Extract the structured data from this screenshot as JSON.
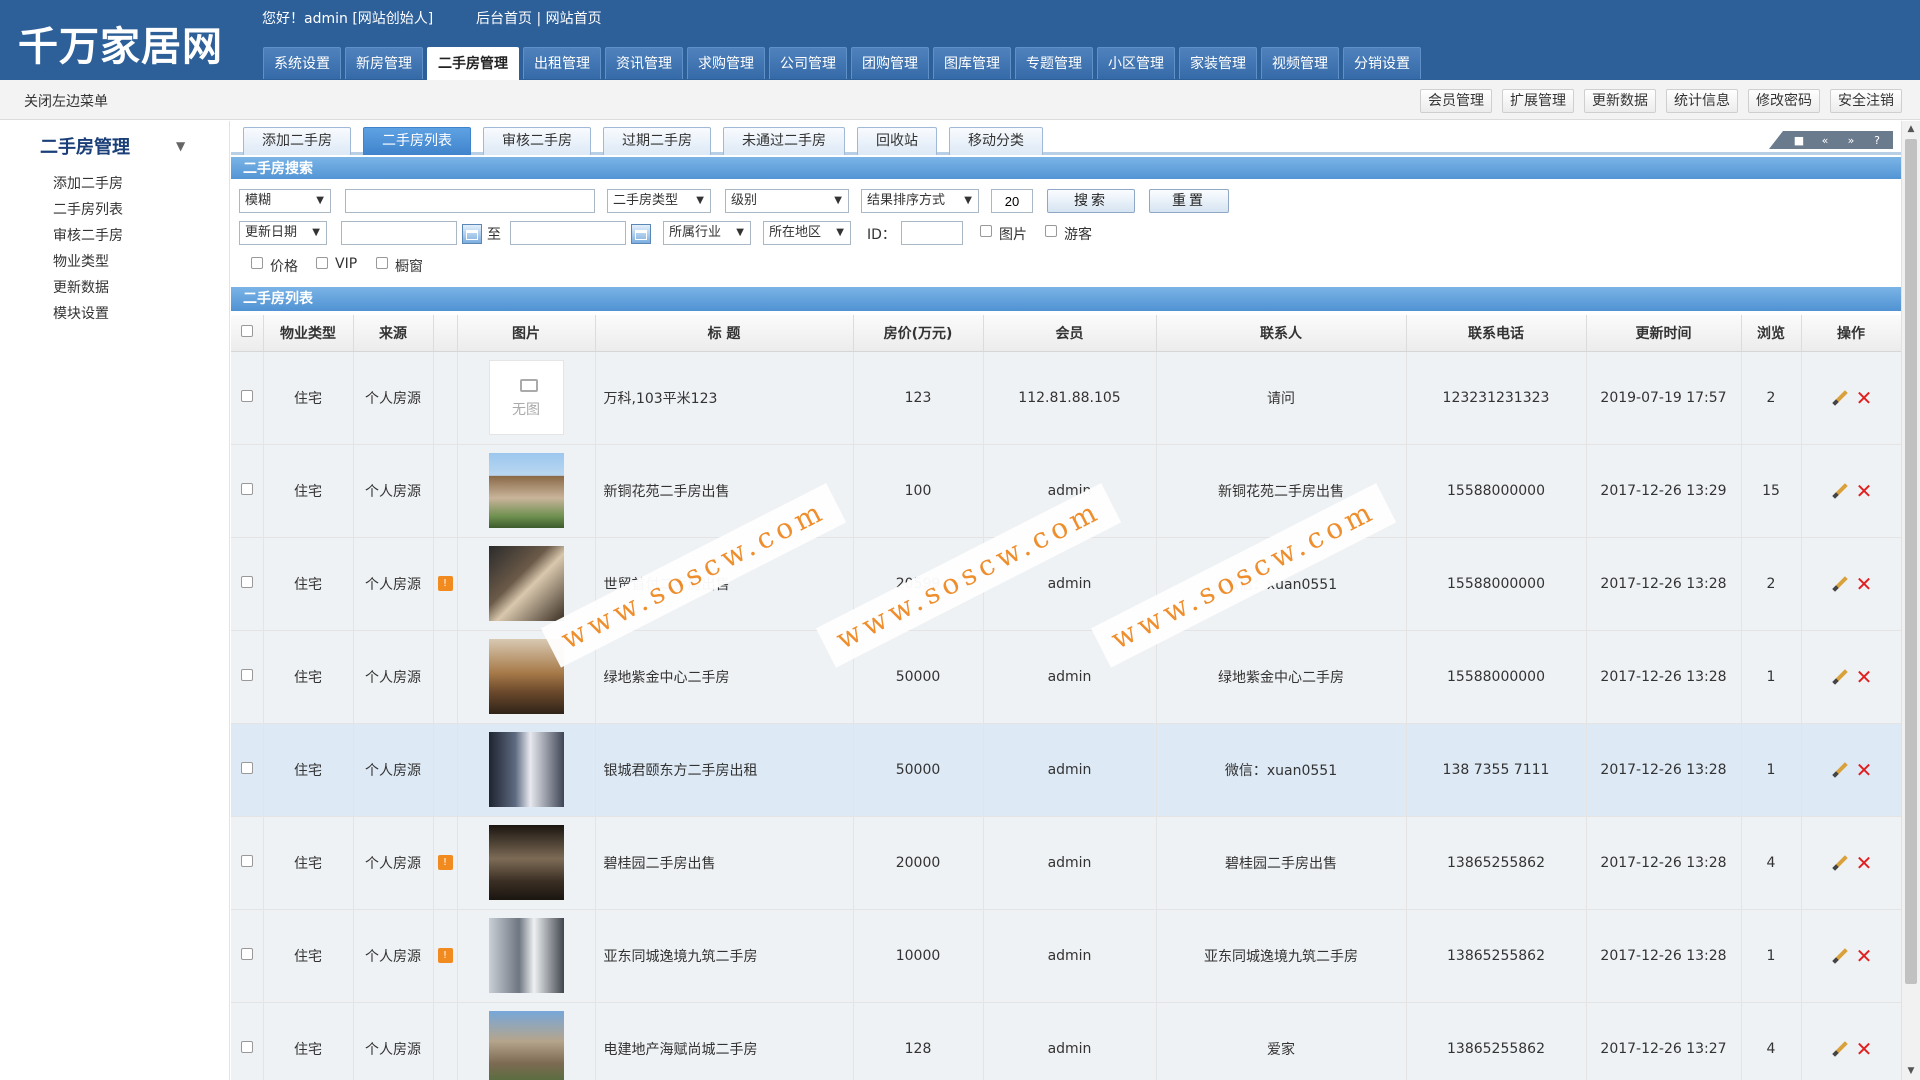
{
  "header": {
    "logo": "千万家居网",
    "greeting": "您好！admin [网站创始人]",
    "links": [
      "后台首页",
      "网站首页"
    ],
    "nav": [
      "系统设置",
      "新房管理",
      "二手房管理",
      "出租管理",
      "资讯管理",
      "求购管理",
      "公司管理",
      "团购管理",
      "图库管理",
      "专题管理",
      "小区管理",
      "家装管理",
      "视频管理",
      "分销设置"
    ],
    "nav_active": "二手房管理"
  },
  "subbar": {
    "close_menu": "关闭左边菜单",
    "buttons": [
      "会员管理",
      "扩展管理",
      "更新数据",
      "统计信息",
      "修改密码",
      "安全注销"
    ]
  },
  "sidebar": {
    "title": "二手房管理",
    "items": [
      "添加二手房",
      "二手房列表",
      "审核二手房",
      "物业类型",
      "更新数据",
      "模块设置"
    ]
  },
  "tabs": {
    "items": [
      "添加二手房",
      "二手房列表",
      "审核二手房",
      "过期二手房",
      "未通过二手房",
      "回收站",
      "移动分类"
    ],
    "active": "二手房列表"
  },
  "search": {
    "section_title": "二手房搜索",
    "match_mode": "模糊",
    "keyword": "",
    "type_select": "二手房类型",
    "level_select": "级别",
    "sort_select": "结果排序方式",
    "page_size": "20",
    "search_button": "搜索",
    "reset_button": "重置",
    "date_select": "更新日期",
    "date_to": "至",
    "industry_select": "所属行业",
    "region_select": "所在地区",
    "id_label": "ID：",
    "checks": [
      "图片",
      "游客",
      "价格",
      "VIP",
      "橱窗"
    ]
  },
  "list": {
    "section_title": "二手房列表",
    "columns": [
      "物业类型",
      "来源",
      "图片",
      "标 题",
      "房价(万元)",
      "会员",
      "联系人",
      "联系电话",
      "更新时间",
      "浏览",
      "操作"
    ],
    "no_image_text": "无图",
    "badge_symbol": "!",
    "rows": [
      {
        "type": "住宅",
        "source": "个人房源",
        "badge": false,
        "img": "none",
        "title": "万科,103平米123",
        "price": "123",
        "member": "112.81.88.105",
        "contact": "请问",
        "phone": "123231231323",
        "time": "2019-07-19 17:57",
        "views": "2",
        "highlight": false
      },
      {
        "type": "住宅",
        "source": "个人房源",
        "badge": false,
        "img": "t-a",
        "title": "新铜花苑二手房出售",
        "price": "100",
        "member": "admin",
        "contact": "新铜花苑二手房出售",
        "phone": "15588000000",
        "time": "2017-12-26 13:29",
        "views": "15",
        "highlight": false
      },
      {
        "type": "住宅",
        "source": "个人房源",
        "badge": true,
        "img": "t-b",
        "title": "世贸首付二手房出售",
        "price": "20599",
        "member": "admin",
        "contact": "微信：xuan0551",
        "phone": "15588000000",
        "time": "2017-12-26 13:28",
        "views": "2",
        "highlight": false
      },
      {
        "type": "住宅",
        "source": "个人房源",
        "badge": false,
        "img": "t-c",
        "title": "绿地紫金中心二手房",
        "price": "50000",
        "member": "admin",
        "contact": "绿地紫金中心二手房",
        "phone": "15588000000",
        "time": "2017-12-26 13:28",
        "views": "1",
        "highlight": false
      },
      {
        "type": "住宅",
        "source": "个人房源",
        "badge": false,
        "img": "t-d",
        "title": "银城君颐东方二手房出租",
        "price": "50000",
        "member": "admin",
        "contact": "微信：xuan0551",
        "phone": "138 7355 7111",
        "time": "2017-12-26 13:28",
        "views": "1",
        "highlight": true
      },
      {
        "type": "住宅",
        "source": "个人房源",
        "badge": true,
        "img": "t-e",
        "title": "碧桂园二手房出售",
        "price": "20000",
        "member": "admin",
        "contact": "碧桂园二手房出售",
        "phone": "13865255862",
        "time": "2017-12-26 13:28",
        "views": "4",
        "highlight": false
      },
      {
        "type": "住宅",
        "source": "个人房源",
        "badge": true,
        "img": "t-f",
        "title": "亚东同城逸境九筑二手房",
        "price": "10000",
        "member": "admin",
        "contact": "亚东同城逸境九筑二手房",
        "phone": "13865255862",
        "time": "2017-12-26 13:28",
        "views": "1",
        "highlight": false
      },
      {
        "type": "住宅",
        "source": "个人房源",
        "badge": false,
        "img": "t-g",
        "title": "电建地产海赋尚城二手房",
        "price": "128",
        "member": "admin",
        "contact": "爱家",
        "phone": "13865255862",
        "time": "2017-12-26 13:27",
        "views": "4",
        "highlight": false
      }
    ]
  },
  "watermark": "www.soscw.com",
  "toolbar_icons": [
    "■",
    "«",
    "»",
    "?"
  ]
}
